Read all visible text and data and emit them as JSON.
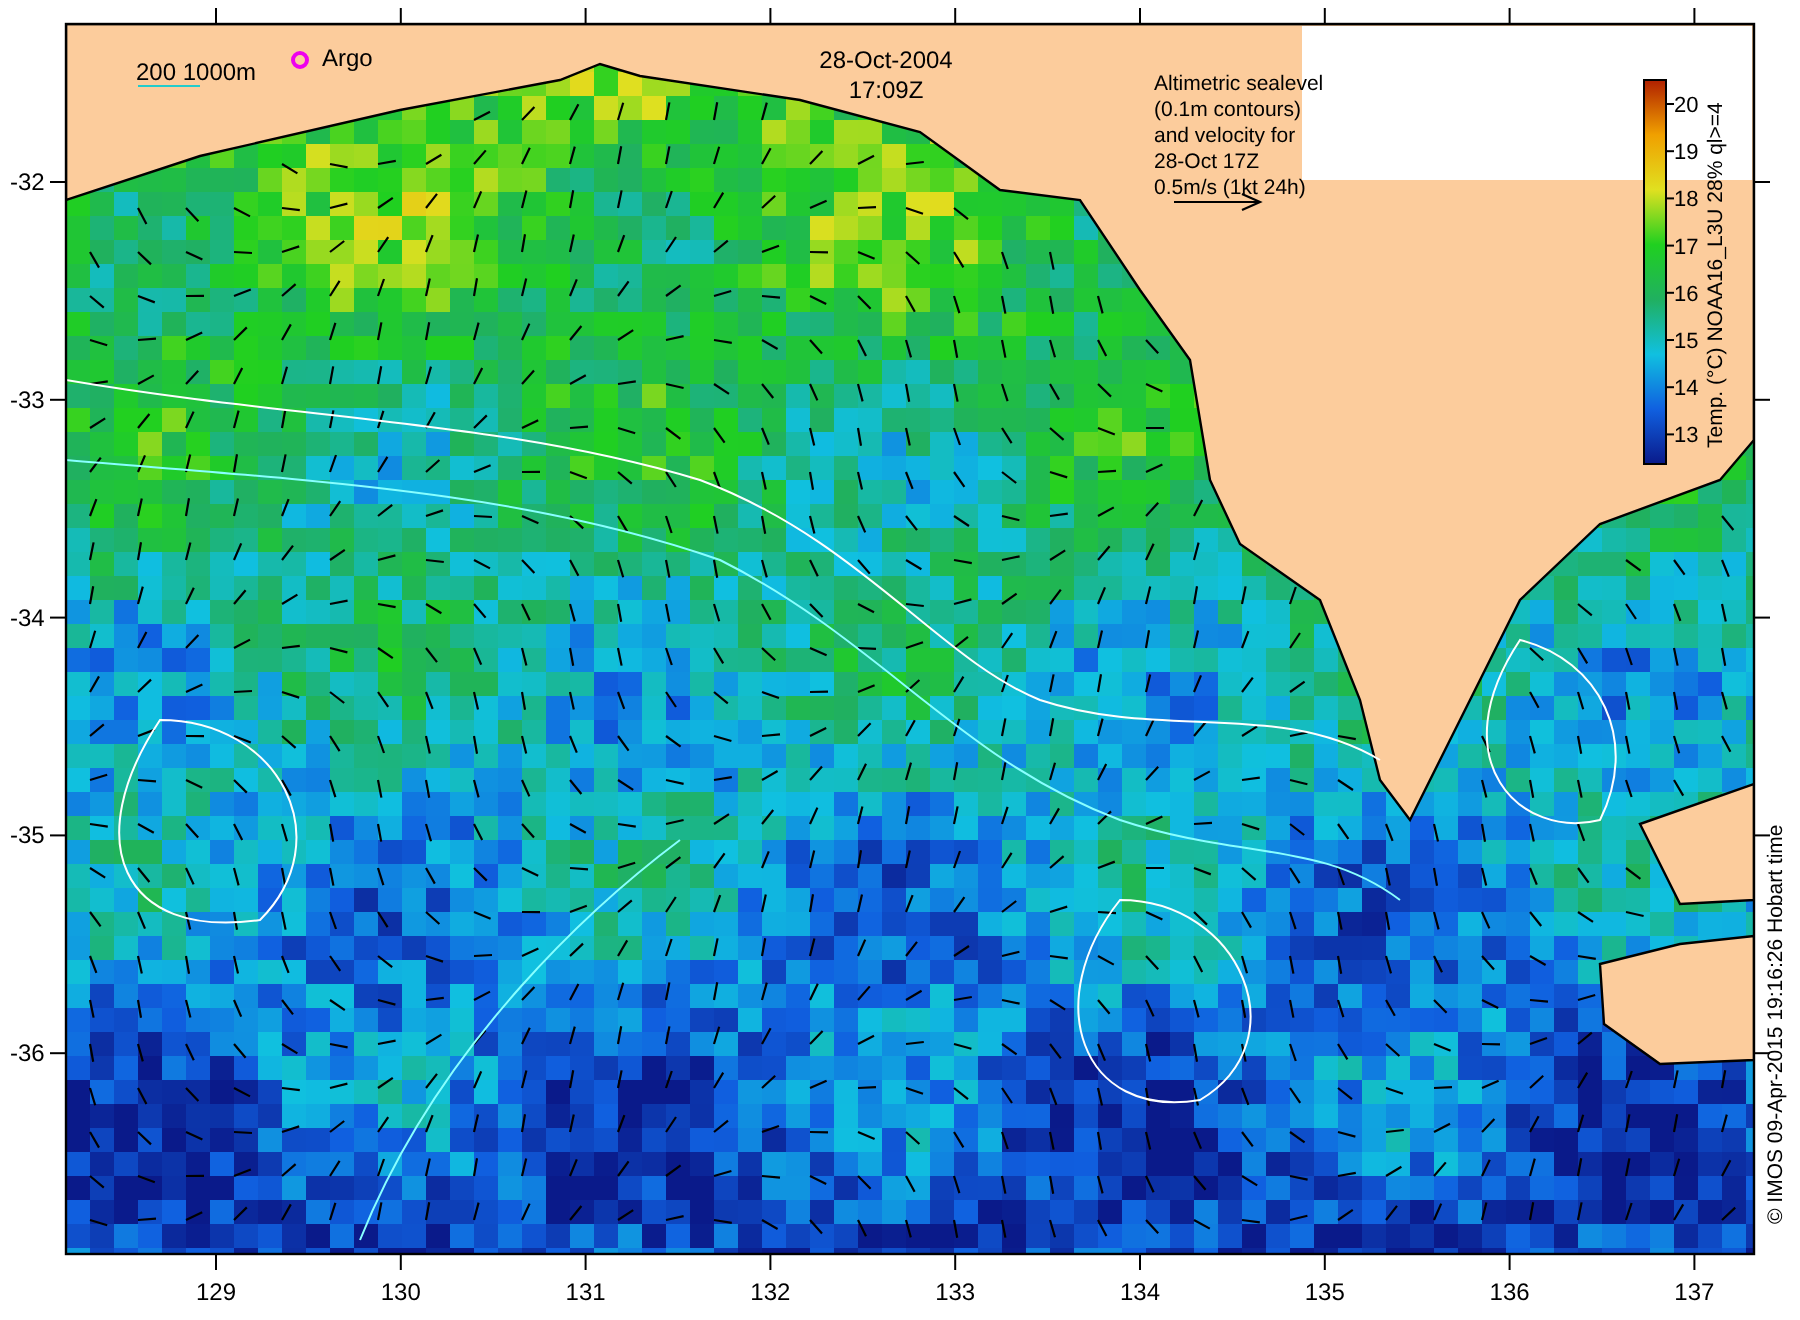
{
  "map": {
    "date": "28-Oct-2004",
    "time": "17:09Z",
    "scale_label": "200 1000m",
    "argo_label": "Argo",
    "legend_lines": [
      "Altimetric sealevel",
      "(0.1m contours)",
      "and velocity for",
      "28-Oct 17Z",
      "0.5m/s (1kt 24h)"
    ],
    "x_ticks": [
      "129",
      "130",
      "131",
      "132",
      "133",
      "134",
      "135",
      "136",
      "137"
    ],
    "y_ticks": [
      "-32",
      "-33",
      "-34",
      "-35",
      "-36"
    ]
  },
  "colorbar": {
    "label": "Temp. (°C) NOAA16_L3U 28% ql>=4",
    "ticks": [
      "20",
      "19",
      "18",
      "17",
      "16",
      "15",
      "14",
      "13"
    ]
  },
  "credit": "© IMOS 09-Apr-2015 19:16:26 Hobart time"
}
